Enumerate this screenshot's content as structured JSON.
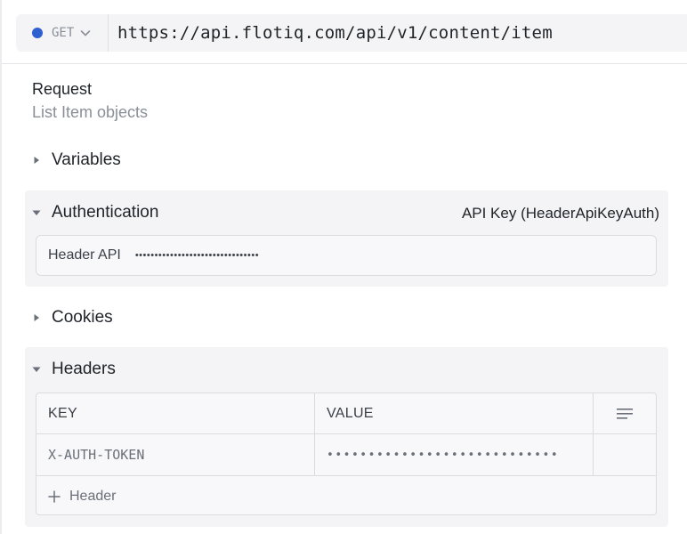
{
  "request_bar": {
    "method": "GET",
    "method_color": "#2f5fd0",
    "url": "https://api.flotiq.com/api/v1/content/item"
  },
  "request": {
    "title": "Request",
    "subtitle": "List Item objects"
  },
  "sections": {
    "variables": {
      "label": "Variables",
      "expanded": false
    },
    "authentication": {
      "label": "Authentication",
      "expanded": true,
      "scheme": "API Key (HeaderApiKeyAuth)",
      "field_label": "Header API",
      "field_value": "••••••••••••••••••••••••••••••••"
    },
    "cookies": {
      "label": "Cookies",
      "expanded": false
    },
    "headers": {
      "label": "Headers",
      "expanded": true,
      "columns": {
        "key": "KEY",
        "value": "VALUE"
      },
      "rows": [
        {
          "key": "X-AUTH-TOKEN",
          "value": "••••••••••••••••••••••••••••"
        }
      ],
      "add_label": "Header"
    }
  },
  "icons": {
    "method_dropdown": "chevron-down-icon",
    "collapsed": "caret-right-icon",
    "expanded": "caret-down-icon",
    "bulk_edit": "list-icon",
    "add": "plus-icon"
  }
}
